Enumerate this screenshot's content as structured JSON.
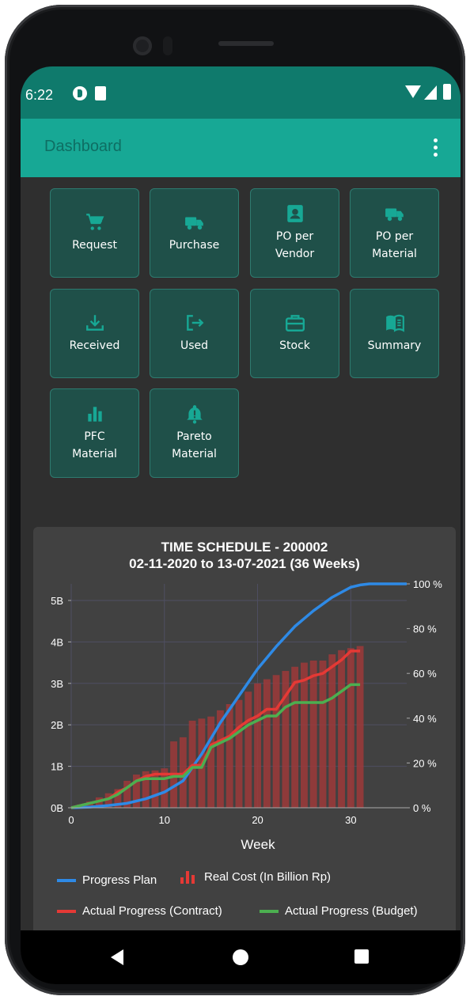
{
  "status_bar": {
    "time": "6:22"
  },
  "app_bar": {
    "title": "Dashboard"
  },
  "menu_tiles": [
    {
      "label": "Request",
      "icon": "cart-icon"
    },
    {
      "label": "Purchase",
      "icon": "truck-icon"
    },
    {
      "label": "PO per\nVendor",
      "icon": "contact-card-icon"
    },
    {
      "label": "PO per\nMaterial",
      "icon": "truck-icon"
    },
    {
      "label": "Received",
      "icon": "download-icon"
    },
    {
      "label": "Used",
      "icon": "logout-icon"
    },
    {
      "label": "Stock",
      "icon": "briefcase-icon"
    },
    {
      "label": "Summary",
      "icon": "book-icon"
    },
    {
      "label": "PFC\nMaterial",
      "icon": "bar-chart-icon"
    },
    {
      "label": "Pareto\nMaterial",
      "icon": "bell-alert-icon"
    }
  ],
  "chart_card": {
    "title_line1": "TIME SCHEDULE - 200002",
    "title_line2": "02-11-2020 to 13-07-2021 (36 Weeks)",
    "legend": {
      "progress_plan": "Progress Plan",
      "real_cost": "Real Cost (In Billion Rp)",
      "actual_contract": "Actual Progress (Contract)",
      "actual_budget": "Actual Progress (Budget)"
    }
  },
  "colors": {
    "progress_plan": "#2e8ae6",
    "real_cost": "#9e3a3a",
    "actual_contract": "#e53935",
    "actual_budget": "#4caf50",
    "accent": "#17a895"
  },
  "chart_data": {
    "type": "bar+line",
    "title": "TIME SCHEDULE - 200002\n02-11-2020 to 13-07-2021 (36 Weeks)",
    "xlabel": "Week",
    "x_ticks": [
      0,
      10,
      20,
      30
    ],
    "xlim": [
      0,
      36
    ],
    "left_axis": {
      "ticks": [
        "0B",
        "1B",
        "2B",
        "3B",
        "4B",
        "5B"
      ],
      "ylim": [
        0,
        5.4
      ]
    },
    "right_axis": {
      "ticks": [
        "0 %",
        "20 %",
        "40 %",
        "60 %",
        "80 %",
        "100 %"
      ],
      "ylim": [
        0,
        100
      ]
    },
    "series": [
      {
        "name": "Real Cost (In Billion Rp)",
        "kind": "bar",
        "axis": "left",
        "x": [
          1,
          2,
          3,
          4,
          5,
          6,
          7,
          8,
          9,
          10,
          11,
          12,
          13,
          14,
          15,
          16,
          17,
          18,
          19,
          20,
          21,
          22,
          23,
          24,
          25,
          26,
          27,
          28,
          29,
          30,
          31
        ],
        "values": [
          0.08,
          0.15,
          0.25,
          0.35,
          0.45,
          0.65,
          0.8,
          0.88,
          0.9,
          0.95,
          1.6,
          1.7,
          2.1,
          2.15,
          2.2,
          2.35,
          2.5,
          2.6,
          2.8,
          3.0,
          3.1,
          3.2,
          3.3,
          3.4,
          3.5,
          3.55,
          3.55,
          3.7,
          3.8,
          3.85,
          3.9
        ]
      },
      {
        "name": "Progress Plan",
        "kind": "line",
        "axis": "right",
        "x": [
          0,
          2,
          4,
          6,
          8,
          10,
          12,
          14,
          16,
          18,
          20,
          22,
          24,
          26,
          28,
          30,
          31,
          32,
          34,
          36
        ],
        "values": [
          0,
          0.3,
          1,
          2,
          4,
          7,
          12,
          24,
          38,
          50,
          62,
          72,
          81,
          88,
          94,
          98.5,
          99.5,
          100,
          100,
          100
        ]
      },
      {
        "name": "Actual Progress (Contract)",
        "kind": "line",
        "axis": "right",
        "x": [
          0,
          2,
          4,
          5,
          6,
          7,
          8,
          9,
          10,
          11,
          12,
          13,
          14,
          15,
          16,
          17,
          18,
          19,
          20,
          21,
          22,
          23,
          24,
          25,
          26,
          27,
          28,
          29,
          30,
          31
        ],
        "values": [
          0,
          2,
          4,
          7,
          9,
          12,
          14,
          15,
          15,
          15,
          15,
          19,
          19,
          28,
          30,
          32,
          36,
          39,
          41,
          44,
          44,
          50,
          56,
          57,
          59,
          60,
          63,
          66,
          70,
          70
        ]
      },
      {
        "name": "Actual Progress (Budget)",
        "kind": "line",
        "axis": "right",
        "x": [
          0,
          2,
          4,
          5,
          6,
          7,
          8,
          9,
          10,
          11,
          12,
          13,
          14,
          15,
          16,
          17,
          18,
          19,
          20,
          21,
          22,
          23,
          24,
          25,
          26,
          27,
          28,
          29,
          30,
          31
        ],
        "values": [
          0,
          2,
          4,
          6,
          9,
          12,
          13,
          13,
          13,
          14,
          14,
          18,
          18,
          27,
          29,
          31,
          34,
          37,
          39,
          41,
          41,
          45,
          47,
          47,
          47,
          47,
          49,
          52,
          55,
          55
        ]
      }
    ],
    "grid": true,
    "legend_position": "bottom"
  }
}
